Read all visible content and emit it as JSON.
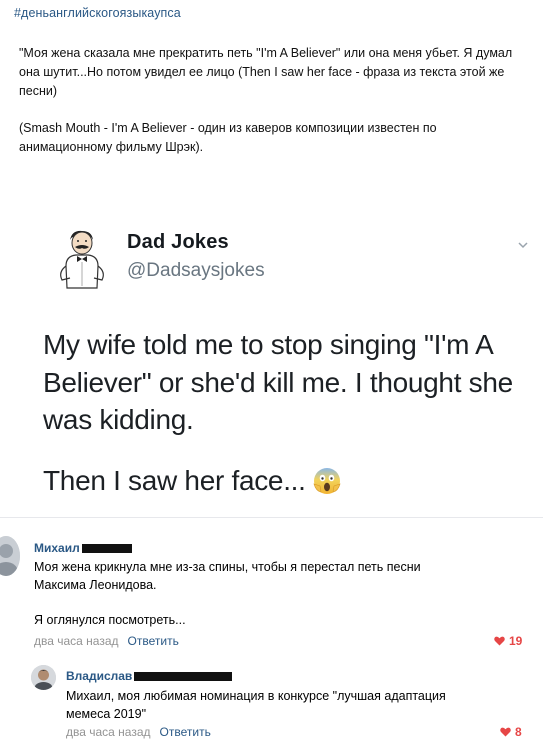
{
  "post": {
    "hashtag": "#деньанглийскогоязыкаупса",
    "paragraph1": "\"Моя жена сказала мне прекратить петь \"I'm A Believer\" или она меня убьет. Я думал она шутит...Но потом увидел ее лицо (Then I saw her face - фраза из текста этой же песни)",
    "paragraph2": "(Smash Mouth - I'm A Believer - один из каверов композиции известен по анимационному фильму Шрэк)."
  },
  "tweet": {
    "name": "Dad Jokes",
    "handle": "@Dadsaysjokes",
    "text_main": "My wife told me to stop singing \"I'm A Believer\" or she'd kill me. I thought she was kidding.",
    "text_punch": "Then I saw her face...",
    "emoji_icon": "face-screaming-in-fear-icon"
  },
  "comments": [
    {
      "author": "Михаил",
      "text_line1": "Моя жена крикнула мне из-за спины, чтобы я перестал петь песни Максима Леонидова.",
      "text_line2": "Я оглянулся посмотреть...",
      "time": "два часа назад",
      "reply_label": "Ответить",
      "likes": "19"
    },
    {
      "author": "Владислав",
      "text": "Михаил, моя любимая номинация в конкурсе \"лучшая адаптация мемеса 2019\"",
      "time": "два часа назад",
      "reply_label": "Ответить",
      "likes": "8"
    }
  ],
  "colors": {
    "link": "#2a5885",
    "meta": "#939393",
    "like": "#e64646"
  }
}
